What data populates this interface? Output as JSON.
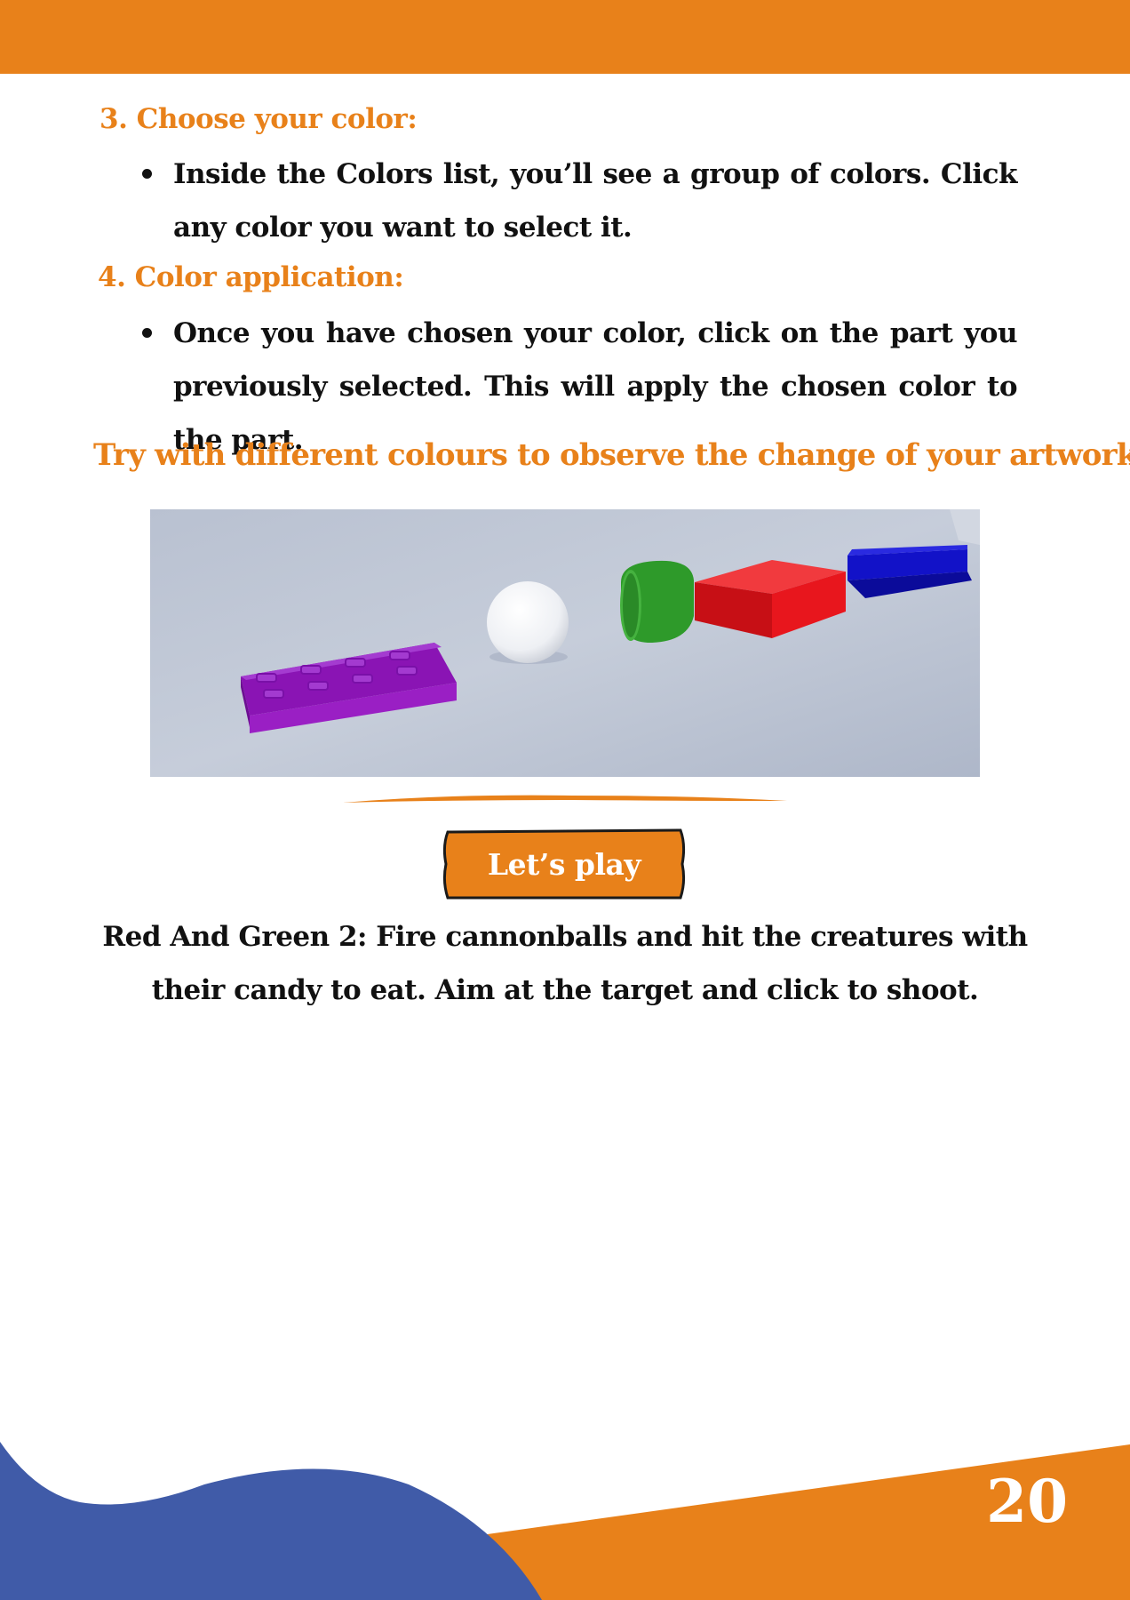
{
  "steps": [
    {
      "heading": "3. Choose your color:",
      "bullet": "Inside the Colors list, you’ll see a group of colors. Click any color you want to select it."
    },
    {
      "heading": "4. Color application:",
      "bullet": "Once you have chosen your color, click on the part you previously selected. This will apply the chosen color to the part."
    }
  ],
  "callout": "Try with different colours to observe the change of your artwork!",
  "play": {
    "label": "Let’s play",
    "description": "Red And Green 2: Fire cannonballs and hit the creatures with their candy to eat. Aim at the target and click to shoot."
  },
  "page_number": "20",
  "colors": {
    "accent_orange": "#E8811A",
    "accent_blue": "#405BA8",
    "text": "#111111"
  },
  "scene_objects": [
    {
      "shape": "block",
      "color": "#9A1FC4"
    },
    {
      "shape": "sphere",
      "color": "#F2F4F8"
    },
    {
      "shape": "cylinder",
      "color": "#2E9A2A"
    },
    {
      "shape": "block",
      "color": "#E8161D"
    },
    {
      "shape": "block",
      "color": "#1212C8"
    }
  ]
}
